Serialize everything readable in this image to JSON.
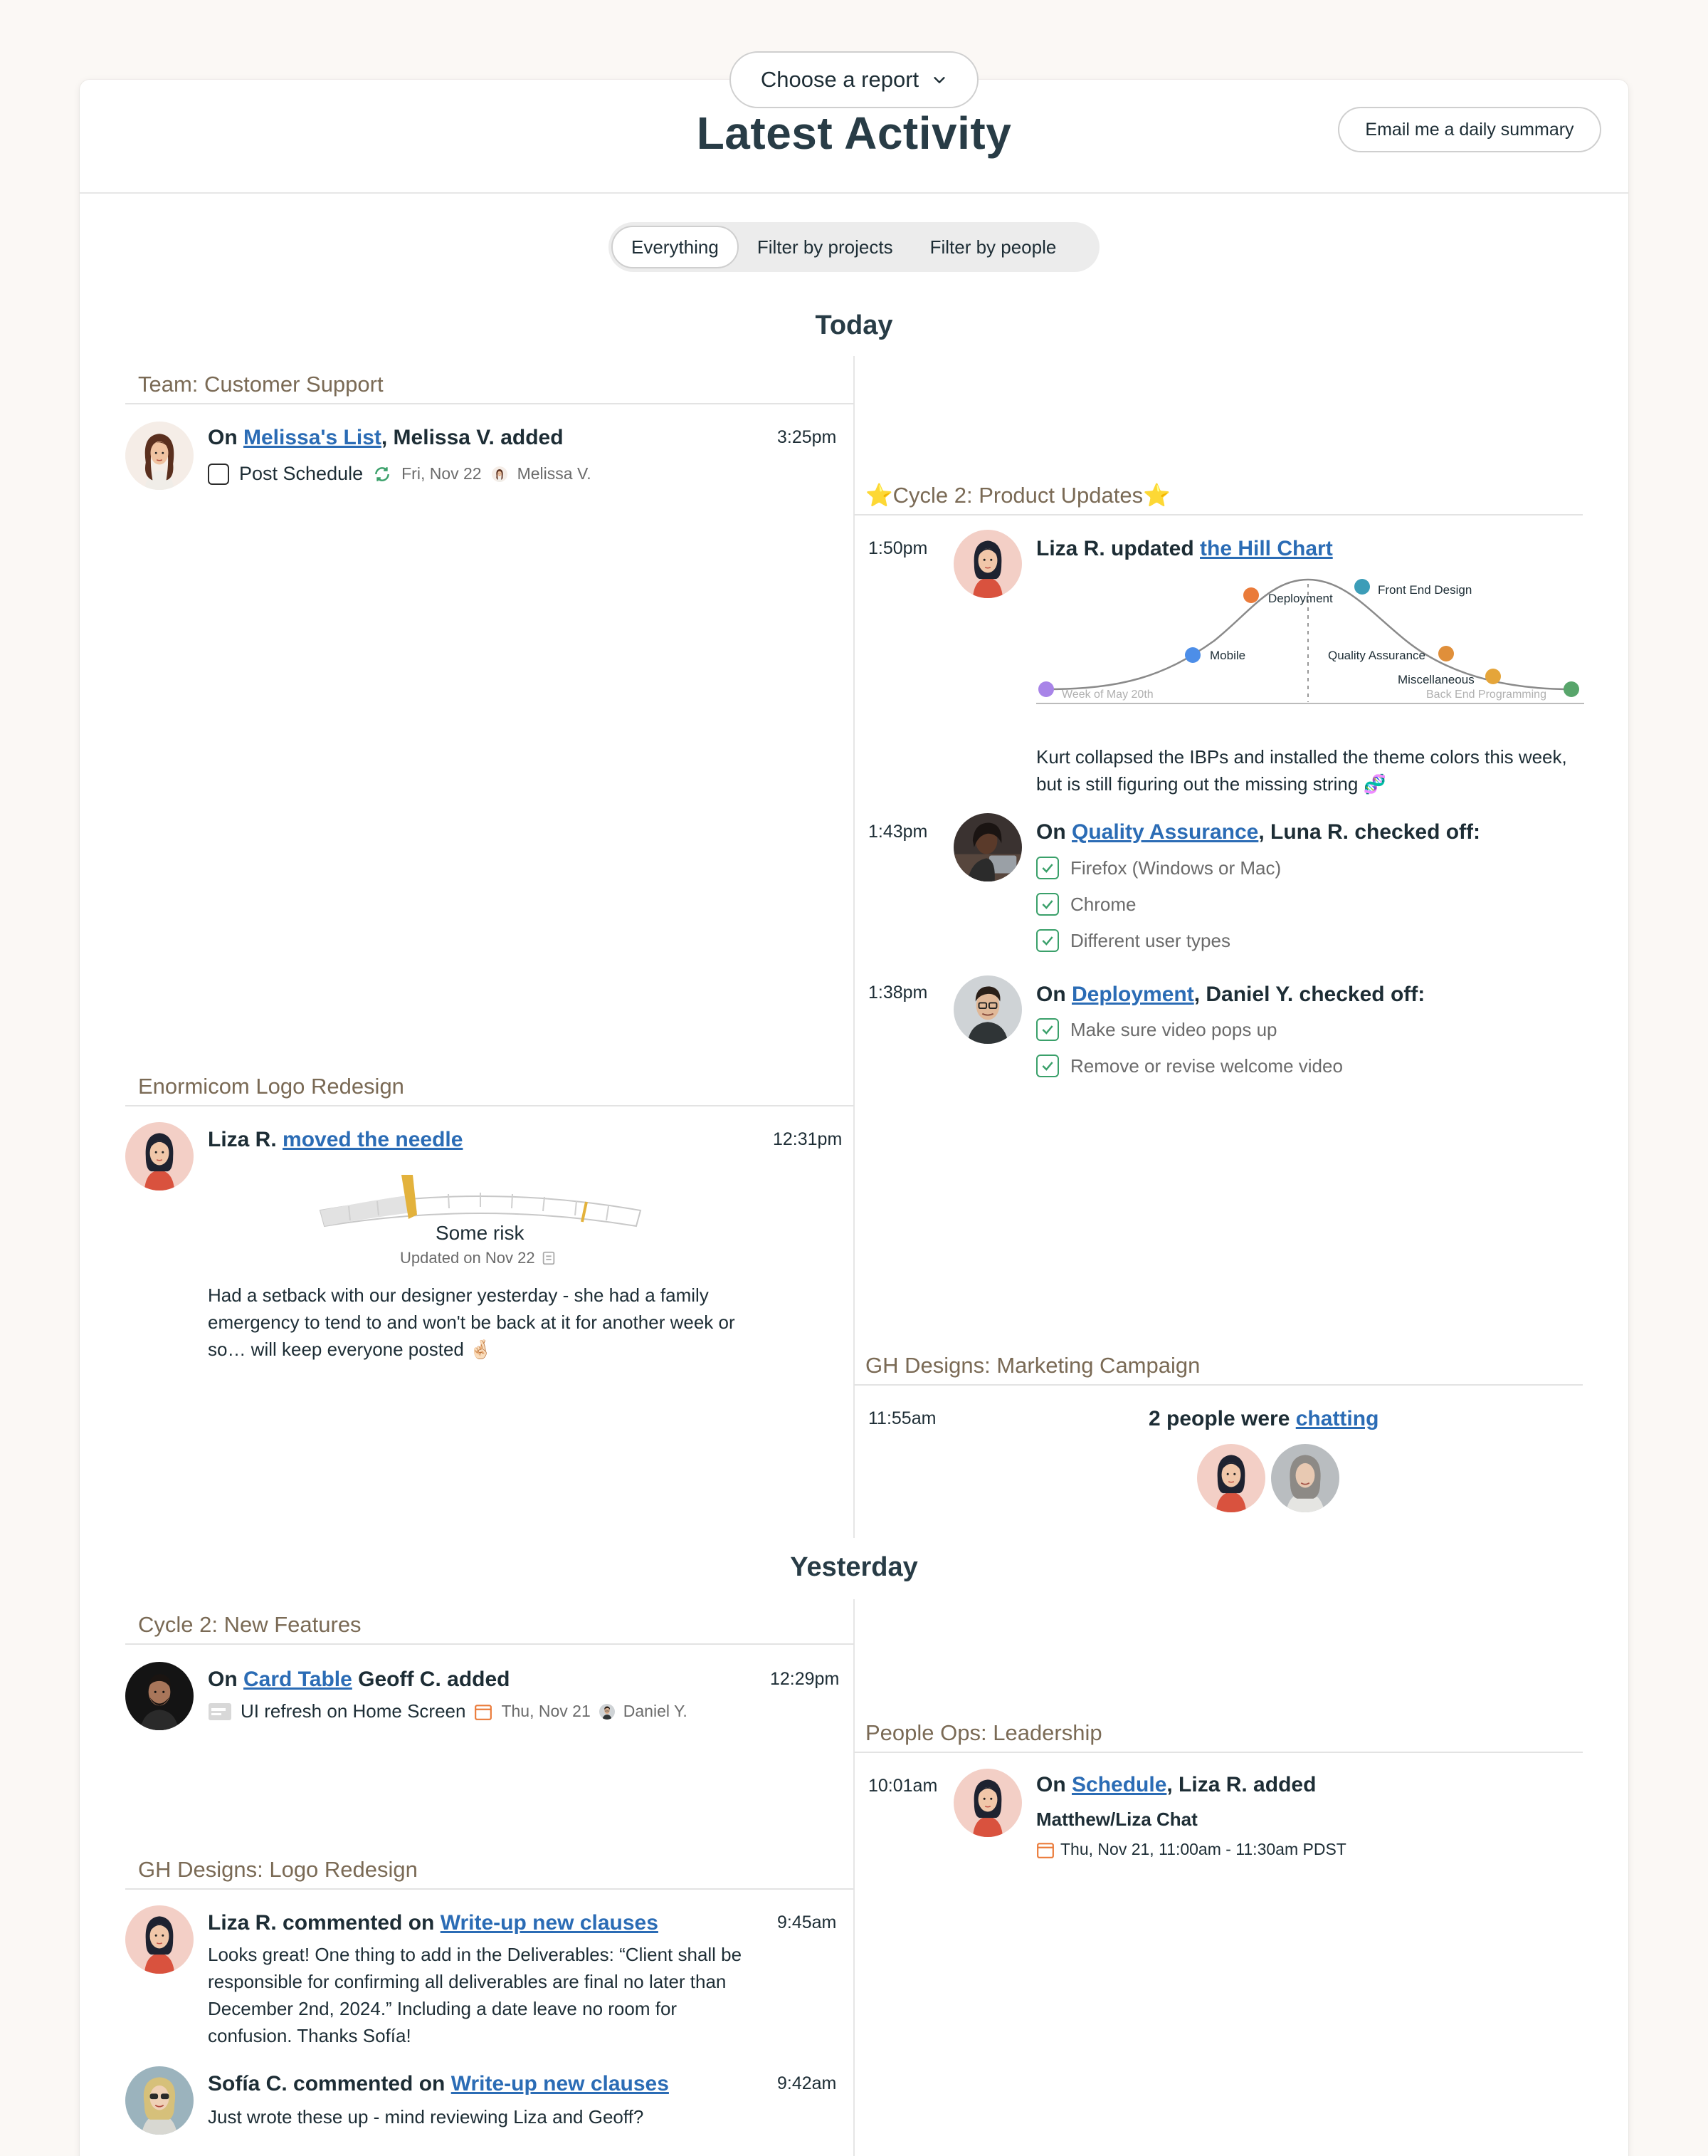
{
  "header": {
    "choose_report": "Choose a report",
    "title": "Latest Activity",
    "email_button": "Email me a daily summary"
  },
  "filters": [
    "Everything",
    "Filter by projects",
    "Filter by people"
  ],
  "today": {
    "heading": "Today",
    "customer_support": {
      "project": "Team: Customer Support",
      "prefix": "On ",
      "link": "Melissa's List",
      "suffix": ", Melissa V. added",
      "time": "3:25pm",
      "todo": "Post Schedule",
      "date": "Fri, Nov 22",
      "assignee": "Melissa V."
    },
    "logo_redesign": {
      "project": "Enormicom Logo Redesign",
      "actor": "Liza R. ",
      "link": "moved the needle",
      "time": "12:31pm",
      "gauge_label": "Some risk",
      "gauge_updated": "Updated on Nov 22",
      "note": "Had a setback with our designer yesterday - she had a family emergency to tend to and won't be back at it for another week or so… will keep everyone posted 🤞🏻"
    },
    "product_updates": {
      "project": "⭐Cycle 2: Product Updates⭐",
      "hill": {
        "time": "1:50pm",
        "prefix": "Liza R. updated ",
        "link": "the Hill Chart",
        "labels": {
          "deployment": "Deployment",
          "front_end": "Front End Design",
          "mobile": "Mobile",
          "qa": "Quality Assurance",
          "misc": "Miscellaneous",
          "week": "Week of May 20th",
          "back_end": "Back End Programming"
        },
        "note": "Kurt collapsed the IBPs and installed the theme colors this week, but is still figuring out the missing string 🧬"
      },
      "qa": {
        "time": "1:43pm",
        "prefix": "On ",
        "link": "Quality Assurance",
        "suffix": ", Luna R. checked off:",
        "items": [
          "Firefox (Windows or Mac)",
          "Chrome",
          "Different user types"
        ]
      },
      "deploy": {
        "time": "1:38pm",
        "prefix": "On ",
        "link": "Deployment",
        "suffix": ", Daniel Y. checked off:",
        "items": [
          "Make sure video pops up",
          "Remove or revise welcome video"
        ]
      }
    },
    "marketing": {
      "project": "GH Designs: Marketing Campaign",
      "time": "11:55am",
      "prefix": "2 people were ",
      "link": "chatting"
    }
  },
  "yesterday": {
    "heading": "Yesterday",
    "new_features": {
      "project": "Cycle 2: New Features",
      "prefix": "On ",
      "link": "Card Table",
      "suffix": " Geoff C. added",
      "time": "12:29pm",
      "card": "UI refresh on Home Screen",
      "date": "Thu, Nov 21",
      "assignee": "Daniel Y."
    },
    "leadership": {
      "project": "People Ops: Leadership",
      "time": "10:01am",
      "prefix": "On ",
      "link": "Schedule",
      "suffix": ", Liza R. added",
      "event": "Matthew/Liza Chat",
      "when": "Thu, Nov 21, 11:00am - 11:30am PDST"
    },
    "gh_logo": {
      "project": "GH Designs: Logo Redesign",
      "c1": {
        "prefix": "Liza R. commented on ",
        "link": "Write-up new clauses",
        "time": "9:45am",
        "text": "Looks great! One thing to add in the Deliverables: “Client shall be responsible for confirming all deliverables are final no later than December 2nd, 2024.” Including a date leave no room for confusion. Thanks Sofía!"
      },
      "c2": {
        "prefix": "Sofía C. commented on ",
        "link": "Write-up new clauses",
        "time": "9:42am",
        "text": "Just wrote these up - mind reviewing Liza and Geoff?"
      }
    }
  },
  "colors": {
    "link": "#2b6cb5",
    "project_label": "#7a6a55",
    "check_green": "#3aa06a",
    "gauge_yellow": "#e3b23c"
  }
}
